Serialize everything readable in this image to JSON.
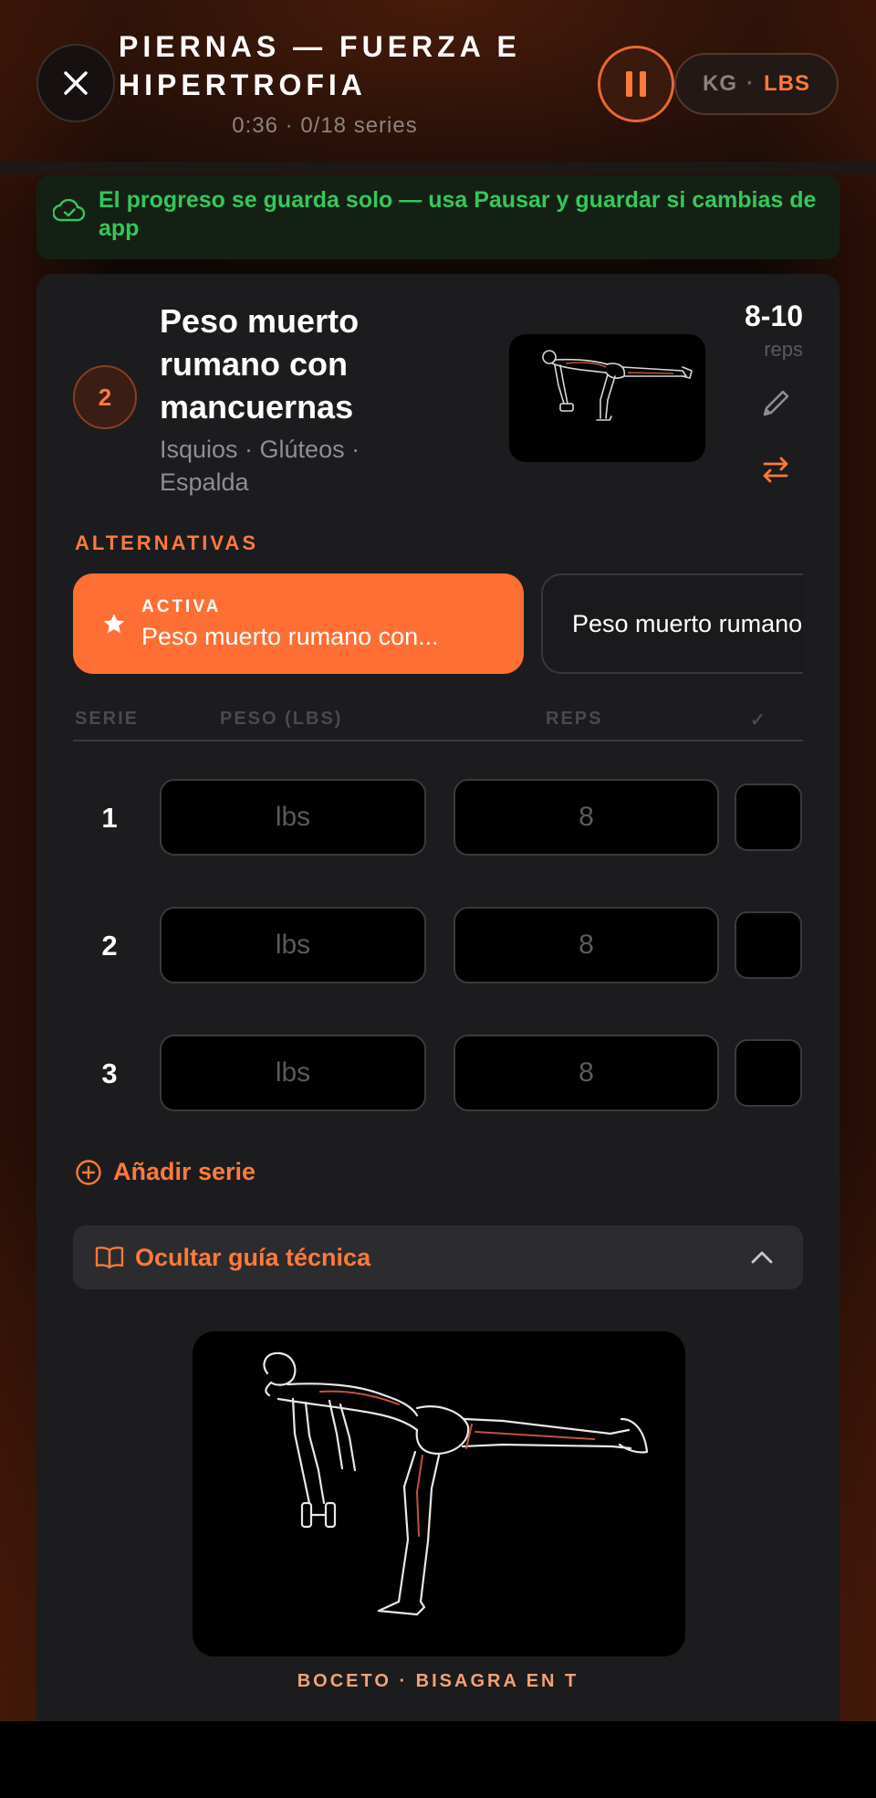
{
  "header": {
    "title": "PIERNAS — FUERZA E HIPERTROFIA",
    "subtitle": "0:36 · 0/18 series",
    "close_icon": "close-icon",
    "pause_icon": "pause-icon",
    "units": {
      "kg": "KG",
      "separator": "·",
      "lbs": "LBS",
      "selected": "LBS"
    }
  },
  "save_banner": {
    "icon": "cloud-check-icon",
    "text": "El progreso se guarda solo — usa Pausar y guardar si cambias de app"
  },
  "exercise": {
    "number": "2",
    "name": "Peso muerto rumano con mancuernas",
    "muscles": "Isquios · Glúteos · Espalda",
    "reps_range": "8-10",
    "reps_unit": "reps",
    "edit_icon": "pencil-icon",
    "swap_icon": "swap-arrows-icon"
  },
  "alternatives": {
    "label": "ALTERNATIVAS",
    "active_tag": "ACTIVA",
    "active_name": "Peso muerto rumano con...",
    "other_name": "Peso muerto rumano con barra"
  },
  "sets_table": {
    "headers": {
      "set": "SERIE",
      "weight": "PESO (LBS)",
      "reps": "REPS",
      "check": "✓"
    },
    "rows": [
      {
        "set": "1",
        "weight_placeholder": "lbs",
        "reps_placeholder": "8"
      },
      {
        "set": "2",
        "weight_placeholder": "lbs",
        "reps_placeholder": "8"
      },
      {
        "set": "3",
        "weight_placeholder": "lbs",
        "reps_placeholder": "8"
      }
    ]
  },
  "add_set_label": "Añadir serie",
  "guide": {
    "toggle_label": "Ocultar guía técnica",
    "caption": "BOCETO · BISAGRA EN T"
  },
  "colors": {
    "accent": "#ff7a3a",
    "success": "#35c75a",
    "card": "#1c1c1e"
  }
}
